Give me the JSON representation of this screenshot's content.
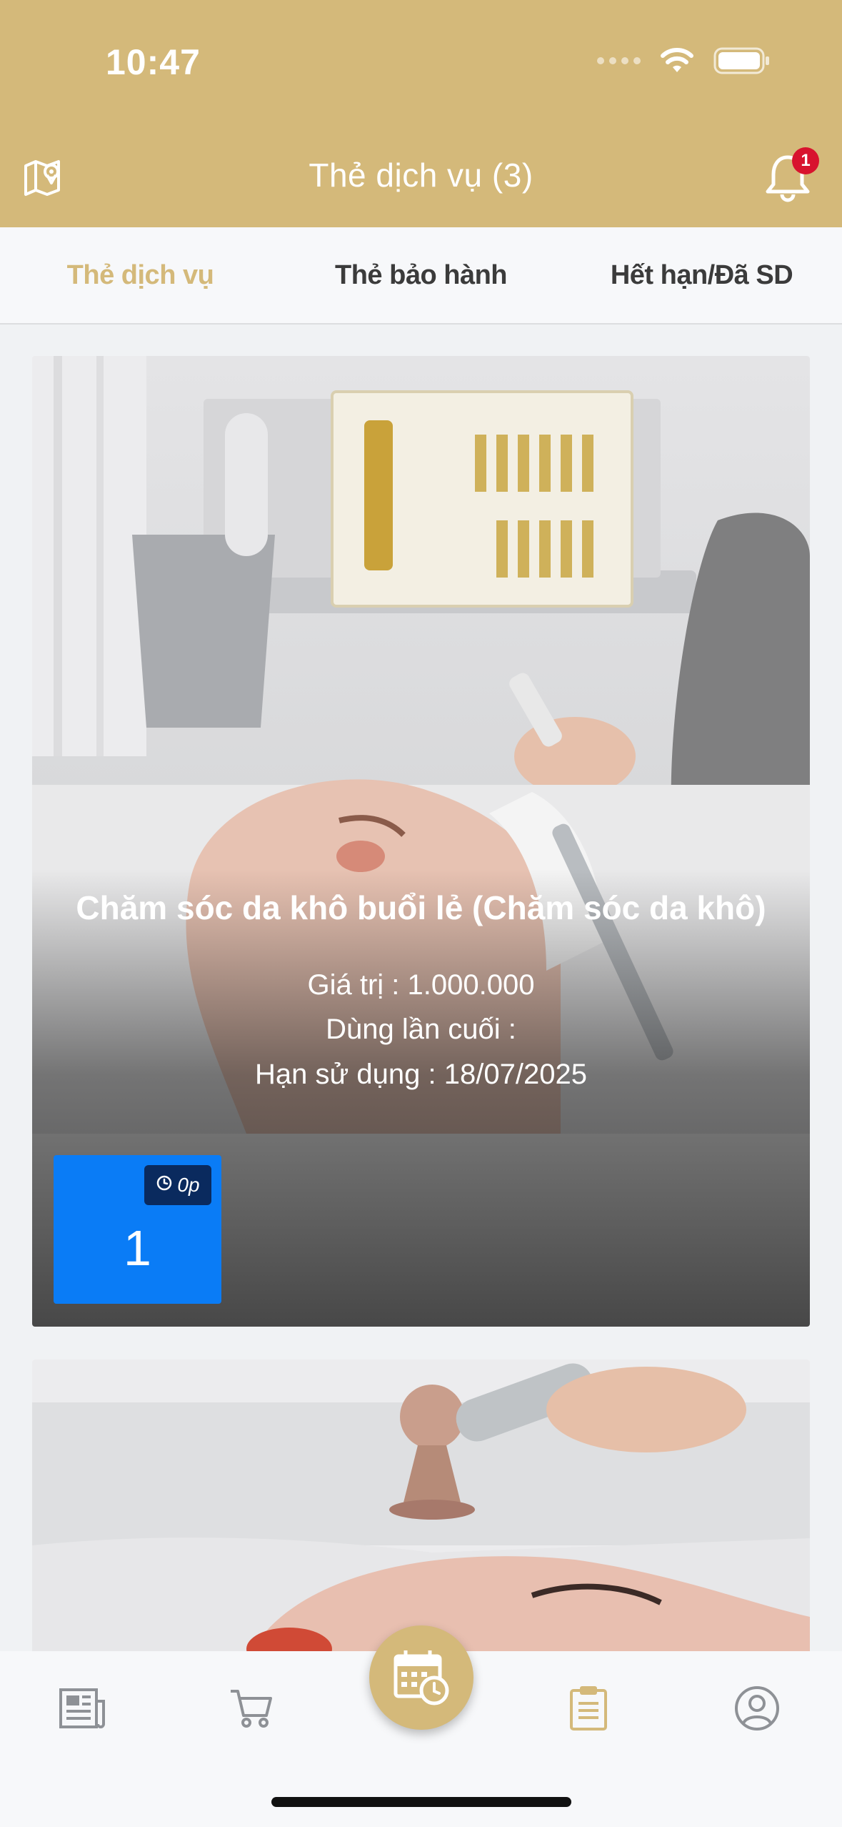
{
  "status_bar": {
    "time": "10:47"
  },
  "header": {
    "title": "Thẻ dịch vụ (3)",
    "map_icon": "map-pin-icon",
    "bell_icon": "bell-icon",
    "notification_count": "1"
  },
  "tabs": [
    {
      "label": "Thẻ dịch vụ",
      "active": true
    },
    {
      "label": "Thẻ bảo hành",
      "active": false
    },
    {
      "label": "Hết hạn/Đã SD",
      "active": false
    }
  ],
  "cards": [
    {
      "title": "Chăm sóc da khô buổi lẻ (Chăm sóc da khô)",
      "value_line": "Giá trị : 1.000.000",
      "last_used_line": "Dùng lần cuối :",
      "expiry_line": "Hạn sử dụng : 18/07/2025",
      "sessions": [
        {
          "count": "1",
          "duration": "0p"
        }
      ]
    }
  ],
  "bottom_nav": [
    {
      "icon": "news-icon"
    },
    {
      "icon": "cart-icon"
    },
    {
      "icon": "calendar-clock-icon"
    },
    {
      "icon": "clipboard-icon"
    },
    {
      "icon": "user-icon"
    }
  ],
  "colors": {
    "brand_gold": "#d4b97a",
    "session_blue": "#0a7cf6",
    "badge_red": "#d8132e"
  }
}
